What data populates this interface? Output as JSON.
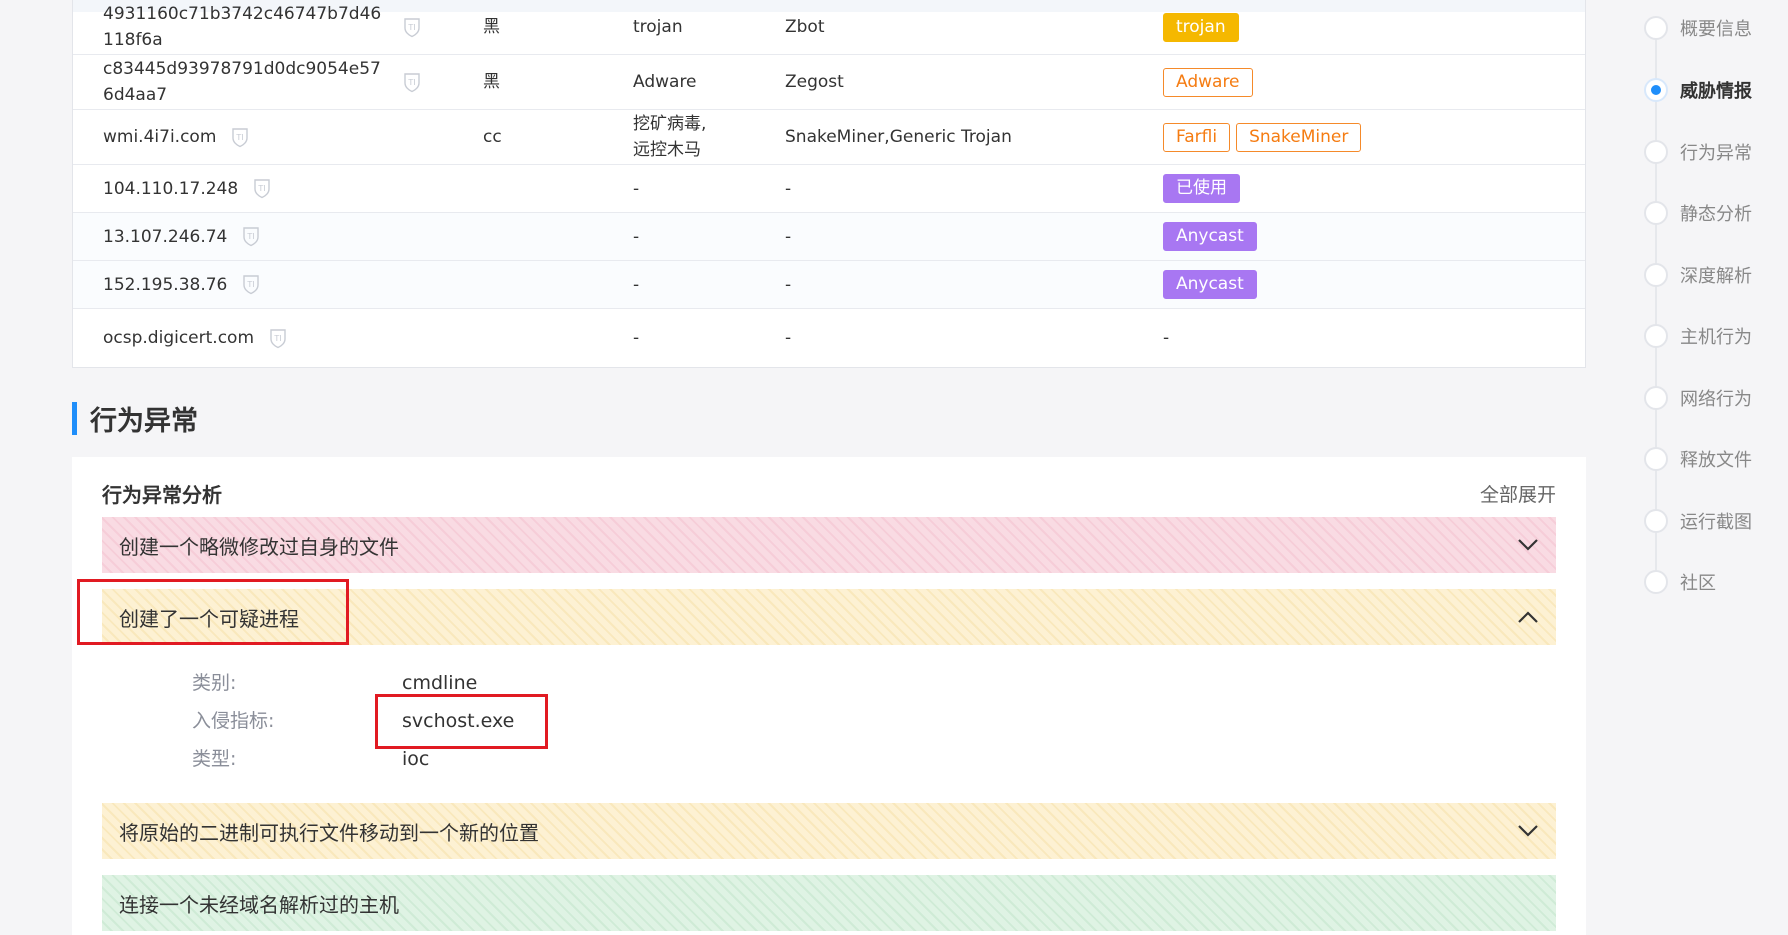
{
  "ioc_table": {
    "rows": [
      {
        "ioc": "4931160c71b3742c46747b7d46118f6a",
        "color": "黑",
        "type": "trojan",
        "family": "Zbot",
        "tags": [
          {
            "text": "trojan",
            "style": "yellow"
          }
        ]
      },
      {
        "ioc": "c83445d93978791d0dc9054e576d4aa7",
        "color": "黑",
        "type": "Adware",
        "family": "Zegost",
        "tags": [
          {
            "text": "Adware",
            "style": "orange-outline"
          }
        ]
      },
      {
        "ioc": "wmi.4i7i.com",
        "color": "cc",
        "type": "挖矿病毒,\n远控木马",
        "family": "SnakeMiner,Generic Trojan",
        "tags": [
          {
            "text": "Farfli",
            "style": "orange-outline"
          },
          {
            "text": "SnakeMiner",
            "style": "orange-outline"
          }
        ]
      },
      {
        "ioc": "104.110.17.248",
        "color": "",
        "type": "-",
        "family": "-",
        "tags": [
          {
            "text": "已使用",
            "style": "purple"
          }
        ]
      },
      {
        "ioc": "13.107.246.74",
        "color": "",
        "type": "-",
        "family": "-",
        "tags": [
          {
            "text": "Anycast",
            "style": "purple"
          }
        ]
      },
      {
        "ioc": "152.195.38.76",
        "color": "",
        "type": "-",
        "family": "-",
        "tags": [
          {
            "text": "Anycast",
            "style": "purple"
          }
        ]
      },
      {
        "ioc": "ocsp.digicert.com",
        "color": "",
        "type": "-",
        "family": "-",
        "tags": [],
        "tags_placeholder": "-"
      }
    ],
    "ti_icon": "ti-shield-icon"
  },
  "section": {
    "title": "行为异常"
  },
  "behavior": {
    "card_title": "行为异常分析",
    "expand_all": "全部展开",
    "items": [
      {
        "label": "创建一个略微修改过自身的文件",
        "severity_color": "#f9dbe3",
        "expanded": false
      },
      {
        "label": "创建了一个可疑进程",
        "severity_color": "#fdf1d3",
        "expanded": true,
        "details": [
          {
            "key": "类别:",
            "value": "cmdline"
          },
          {
            "key": "入侵指标:",
            "value": "svchost.exe"
          },
          {
            "key": "类型:",
            "value": "ioc"
          }
        ]
      },
      {
        "label": "将原始的二进制可执行文件移动到一个新的位置",
        "severity_color": "#fdf1d3",
        "expanded": false
      },
      {
        "label": "连接一个未经域名解析过的主机",
        "severity_color": "#dff3e4",
        "expanded": false
      }
    ]
  },
  "nav": {
    "active_index": 1,
    "accent_color": "#1f8efa",
    "items": [
      "概要信息",
      "威胁情报",
      "行为异常",
      "静态分析",
      "深度解析",
      "主机行为",
      "网络行为",
      "释放文件",
      "运行截图",
      "社区"
    ]
  }
}
